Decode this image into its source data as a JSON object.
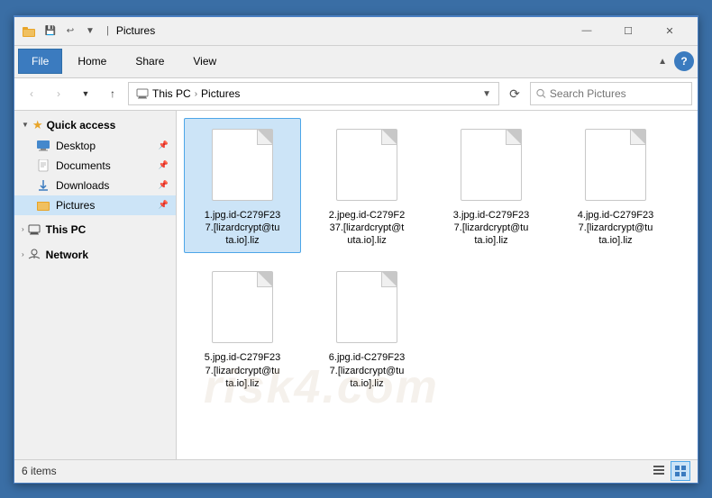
{
  "window": {
    "title": "Pictures",
    "icon": "📁"
  },
  "titlebar": {
    "qs_items": [
      "💾",
      "↩",
      "▼"
    ],
    "minimize": "—",
    "maximize": "☐",
    "close": "✕"
  },
  "ribbon": {
    "tabs": [
      "File",
      "Home",
      "Share",
      "View"
    ],
    "active_tab": "File",
    "help": "?"
  },
  "addressbar": {
    "back": "‹",
    "forward": "›",
    "up": "↑",
    "path": [
      "This PC",
      "Pictures"
    ],
    "refresh": "⟳",
    "search_placeholder": "Search Pictures"
  },
  "sidebar": {
    "sections": [
      {
        "id": "quick-access",
        "label": "Quick access",
        "expanded": true,
        "items": [
          {
            "id": "desktop",
            "label": "Desktop",
            "icon": "desktop",
            "pinned": true
          },
          {
            "id": "documents",
            "label": "Documents",
            "icon": "documents",
            "pinned": true
          },
          {
            "id": "downloads",
            "label": "Downloads",
            "icon": "downloads",
            "pinned": true
          },
          {
            "id": "pictures",
            "label": "Pictures",
            "icon": "pictures",
            "pinned": true,
            "active": true
          }
        ]
      },
      {
        "id": "this-pc",
        "label": "This PC",
        "expanded": false,
        "items": []
      },
      {
        "id": "network",
        "label": "Network",
        "expanded": false,
        "items": []
      }
    ]
  },
  "files": [
    {
      "id": 1,
      "name": "1.jpg.id-C279F23\n7.[lizardcrypt@tu\nta.io].liz",
      "selected": true
    },
    {
      "id": 2,
      "name": "2.jpeg.id-C279F2\n37.[lizardcrypt@t\nuta.io].liz",
      "selected": false
    },
    {
      "id": 3,
      "name": "3.jpg.id-C279F23\n7.[lizardcrypt@tu\nta.io].liz",
      "selected": false
    },
    {
      "id": 4,
      "name": "4.jpg.id-C279F23\n7.[lizardcrypt@tu\nta.io].liz",
      "selected": false
    },
    {
      "id": 5,
      "name": "5.jpg.id-C279F23\n7.[lizardcrypt@tu\nta.io].liz",
      "selected": false
    },
    {
      "id": 6,
      "name": "6.jpg.id-C279F23\n7.[lizardcrypt@tu\nta.io].liz",
      "selected": false
    }
  ],
  "statusbar": {
    "count": "6 items"
  },
  "watermark": "risk4.com"
}
